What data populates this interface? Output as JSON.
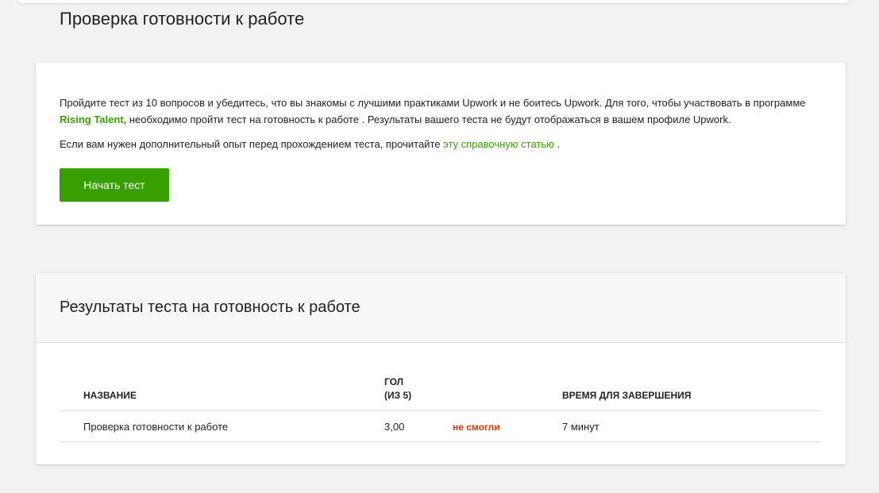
{
  "page": {
    "title": "Проверка готовности к работе"
  },
  "intro": {
    "paragraph1_before_link": "Пройдите тест из 10 вопросов и убедитесь, что вы знакомы с лучшими практиками Upwork и не боитесь Upwork. Для того, чтобы участвовать в программе ",
    "rising_talent_link": "Rising Talent,",
    "paragraph1_after_link": " необходимо пройти тест на готовность к работе . Результаты вашего теста не будут отображаться в вашем профиле Upwork.",
    "paragraph2_before_link": "Если вам нужен дополнительный опыт перед прохождением теста, прочитайте ",
    "help_article_link": "эту справочную статью",
    "paragraph2_after_link": " .",
    "start_button_label": "Начать тест"
  },
  "results": {
    "title": "Результаты теста на готовность к работе",
    "columns": {
      "name": "НАЗВАНИЕ",
      "score_line1": "ГОЛ",
      "score_line2": "(ИЗ 5)",
      "time": "ВРЕМЯ ДЛЯ ЗАВЕРШЕНИЯ"
    },
    "rows": [
      {
        "name": "Проверка готовности к работе",
        "score": "3,00",
        "status": "не смогли",
        "time": "7 минут"
      }
    ]
  },
  "colors": {
    "accent_green": "#37a000",
    "status_fail": "#d93900",
    "background": "#f2f2f2"
  }
}
